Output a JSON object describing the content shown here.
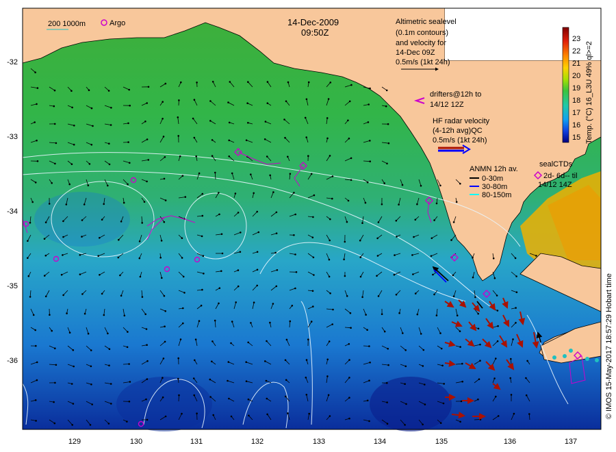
{
  "header": {
    "date": "14-Dec-2009",
    "time": "09:50Z"
  },
  "legend_top": {
    "isobath_label": "200  1000m",
    "argo_label": "Argo"
  },
  "altimetry": {
    "lines": [
      "Altimetric sealevel",
      "(0.1m contours)",
      "and velocity for",
      "14-Dec 09Z",
      "0.5m/s (1kt 24h)"
    ]
  },
  "drifters": {
    "lines": [
      "drifters@12h to",
      "14/12 12Z"
    ]
  },
  "hf_radar": {
    "lines": [
      "HF radar velocity",
      "(4-12h avg)QC",
      "0.5m/s (1kt 24h)"
    ]
  },
  "anmn": {
    "title": "ANMN 12h av.",
    "items": [
      {
        "label": "0-30m",
        "color": "#000000"
      },
      {
        "label": "30-80m",
        "color": "#0000ff"
      },
      {
        "label": "80-150m",
        "color": "#00ffff"
      }
    ]
  },
  "seal_ctds": {
    "title": "sealCTDs",
    "lines": [
      "2d- 6d-- til",
      "14/12 14Z"
    ]
  },
  "colorbar": {
    "title": "Temp. (°C) 16_L3U 49% ql>=2",
    "ticks": [
      "23",
      "22",
      "21",
      "20",
      "19",
      "18",
      "17",
      "16",
      "15"
    ]
  },
  "credit": "© IMOS 15-May-2017 18:57:29 Hobart time",
  "axes": {
    "lat_ticks": [
      "-32",
      "-33",
      "-34",
      "-35",
      "-36"
    ],
    "lon_ticks": [
      "129",
      "130",
      "131",
      "132",
      "133",
      "134",
      "135",
      "136",
      "137"
    ]
  },
  "colors": {
    "land": "#f8c79b",
    "drifter": "#cc00cc",
    "hf_radar": "#aa1100"
  }
}
